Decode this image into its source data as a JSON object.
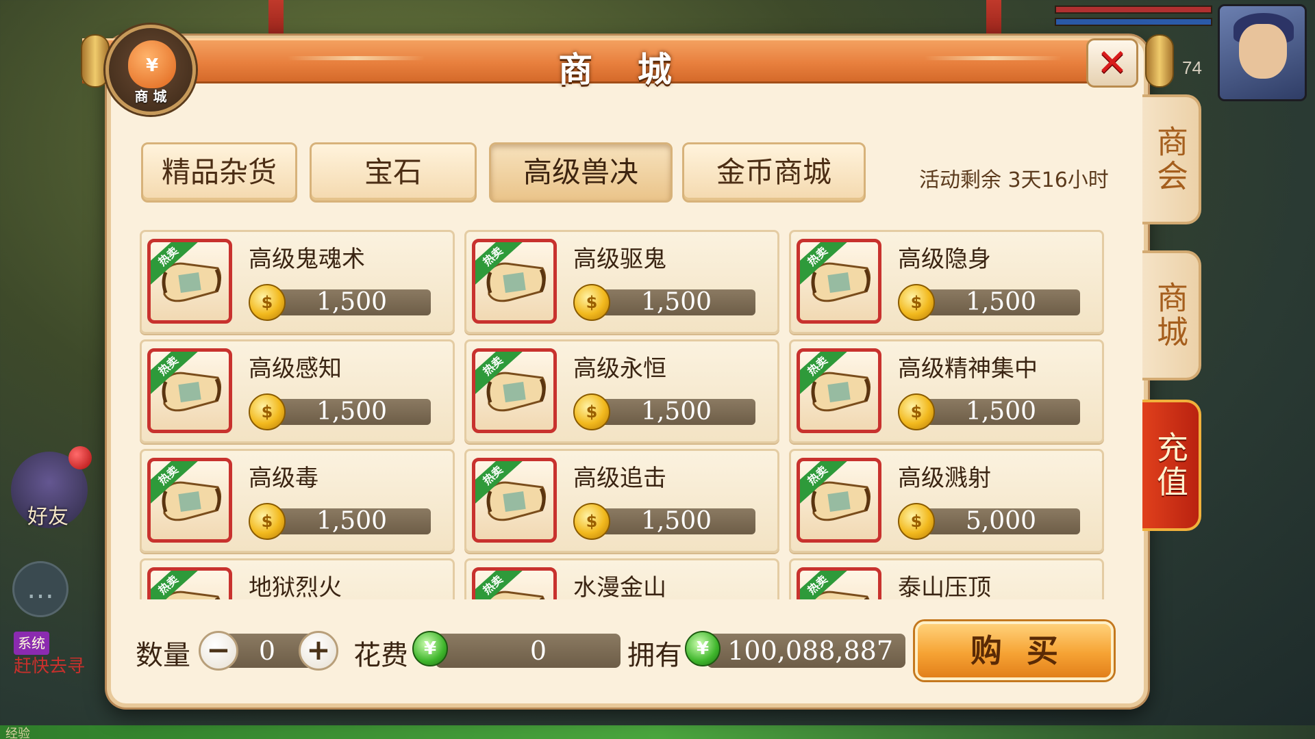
{
  "background": {
    "hud_level": "74",
    "friend_label": "好友",
    "sys_badge": "系统",
    "sys_text": "赶快去寻",
    "exp_label": "经验"
  },
  "dialog": {
    "title": "商 城",
    "logo_symbol": "¥",
    "logo_label": "商 城",
    "close_symbol": "✕"
  },
  "side_tabs": [
    {
      "label": "商会"
    },
    {
      "label": "商城"
    },
    {
      "label": "充值"
    }
  ],
  "categories": [
    {
      "label": "精品杂货",
      "active": false
    },
    {
      "label": "宝石",
      "active": false
    },
    {
      "label": "高级兽决",
      "active": true
    },
    {
      "label": "金币商城",
      "active": false
    }
  ],
  "event_remaining": "活动剩余 3天16小时",
  "hot_tag": "热卖",
  "coin_symbol": "$",
  "items": [
    {
      "name": "高级鬼魂术",
      "price": "1,500"
    },
    {
      "name": "高级驱鬼",
      "price": "1,500"
    },
    {
      "name": "高级隐身",
      "price": "1,500"
    },
    {
      "name": "高级感知",
      "price": "1,500"
    },
    {
      "name": "高级永恒",
      "price": "1,500"
    },
    {
      "name": "高级精神集中",
      "price": "1,500"
    },
    {
      "name": "高级毒",
      "price": "1,500"
    },
    {
      "name": "高级追击",
      "price": "1,500"
    },
    {
      "name": "高级溅射",
      "price": "5,000"
    },
    {
      "name": "地狱烈火",
      "price": ""
    },
    {
      "name": "水漫金山",
      "price": ""
    },
    {
      "name": "泰山压顶",
      "price": ""
    }
  ],
  "purchase": {
    "quantity_label": "数量",
    "minus": "−",
    "plus": "+",
    "quantity_value": "0",
    "cost_label": "花费",
    "cost_value": "0",
    "own_label": "拥有",
    "own_value": "100,088,887",
    "jade_symbol": "¥",
    "buy_label": "购买"
  }
}
